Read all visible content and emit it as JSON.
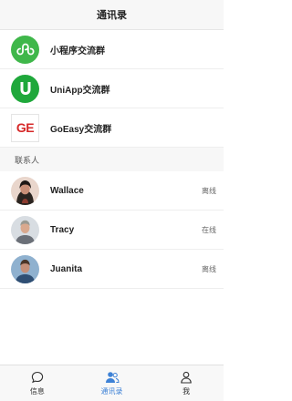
{
  "header": {
    "title": "通讯录"
  },
  "groups": [
    {
      "name": "小程序交流群",
      "icon": "miniprogram-icon"
    },
    {
      "name": "UniApp交流群",
      "icon": "uniapp-icon"
    },
    {
      "name": "GoEasy交流群",
      "icon": "goeasy-logo",
      "logo_text": "GE"
    }
  ],
  "section": {
    "label": "联系人"
  },
  "contacts": [
    {
      "name": "Wallace",
      "status": "离线",
      "avatar": "avatar-wallace"
    },
    {
      "name": "Tracy",
      "status": "在线",
      "avatar": "avatar-tracy"
    },
    {
      "name": "Juanita",
      "status": "离线",
      "avatar": "avatar-juanita"
    }
  ],
  "tabbar": {
    "active": "contacts",
    "tabs": [
      {
        "label": "信息",
        "icon": "chat-bubble-icon"
      },
      {
        "label": "通讯录",
        "icon": "contacts-icon"
      },
      {
        "label": "我",
        "icon": "person-icon"
      }
    ]
  },
  "colors": {
    "accent": "#3e82d6",
    "miniprogram": "#3fb74a",
    "uniapp": "#1fa83b",
    "goeasy": "#d62828"
  }
}
